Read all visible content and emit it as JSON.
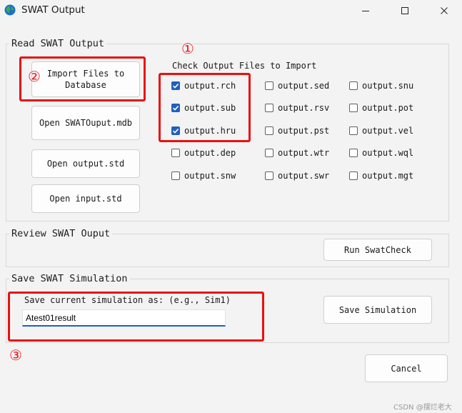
{
  "window": {
    "title": "SWAT Output"
  },
  "read_group": {
    "legend": "Read SWAT Output",
    "buttons": {
      "import": "Import Files to\nDatabase",
      "open_mdb": "Open SWATOuput.mdb",
      "open_std": "Open output.std",
      "open_input": "Open input.std"
    },
    "check_heading": "Check Output Files to Import",
    "files": [
      {
        "label": "output.rch",
        "checked": true
      },
      {
        "label": "output.sed",
        "checked": false
      },
      {
        "label": "output.snu",
        "checked": false
      },
      {
        "label": "output.sub",
        "checked": true
      },
      {
        "label": "output.rsv",
        "checked": false
      },
      {
        "label": "output.pot",
        "checked": false
      },
      {
        "label": "output.hru",
        "checked": true
      },
      {
        "label": "output.pst",
        "checked": false
      },
      {
        "label": "output.vel",
        "checked": false
      },
      {
        "label": "output.dep",
        "checked": false
      },
      {
        "label": "output.wtr",
        "checked": false
      },
      {
        "label": "output.wql",
        "checked": false
      },
      {
        "label": "output.snw",
        "checked": false
      },
      {
        "label": "output.swr",
        "checked": false
      },
      {
        "label": "output.mgt",
        "checked": false
      }
    ]
  },
  "review_group": {
    "legend": "Review SWAT Ouput",
    "run_label": "Run SwatCheck"
  },
  "save_group": {
    "legend": "Save SWAT Simulation",
    "prompt": "Save current simulation as: (e.g., Sim1)",
    "input_value": "Atest01result",
    "save_label": "Save Simulation"
  },
  "cancel_label": "Cancel",
  "annotations": {
    "n1": "①",
    "n2": "②",
    "n3": "③"
  },
  "watermark": "CSDN @摆烂老大",
  "colors": {
    "annotation_red": "#ea1010",
    "check_blue": "#1f5fbf"
  }
}
